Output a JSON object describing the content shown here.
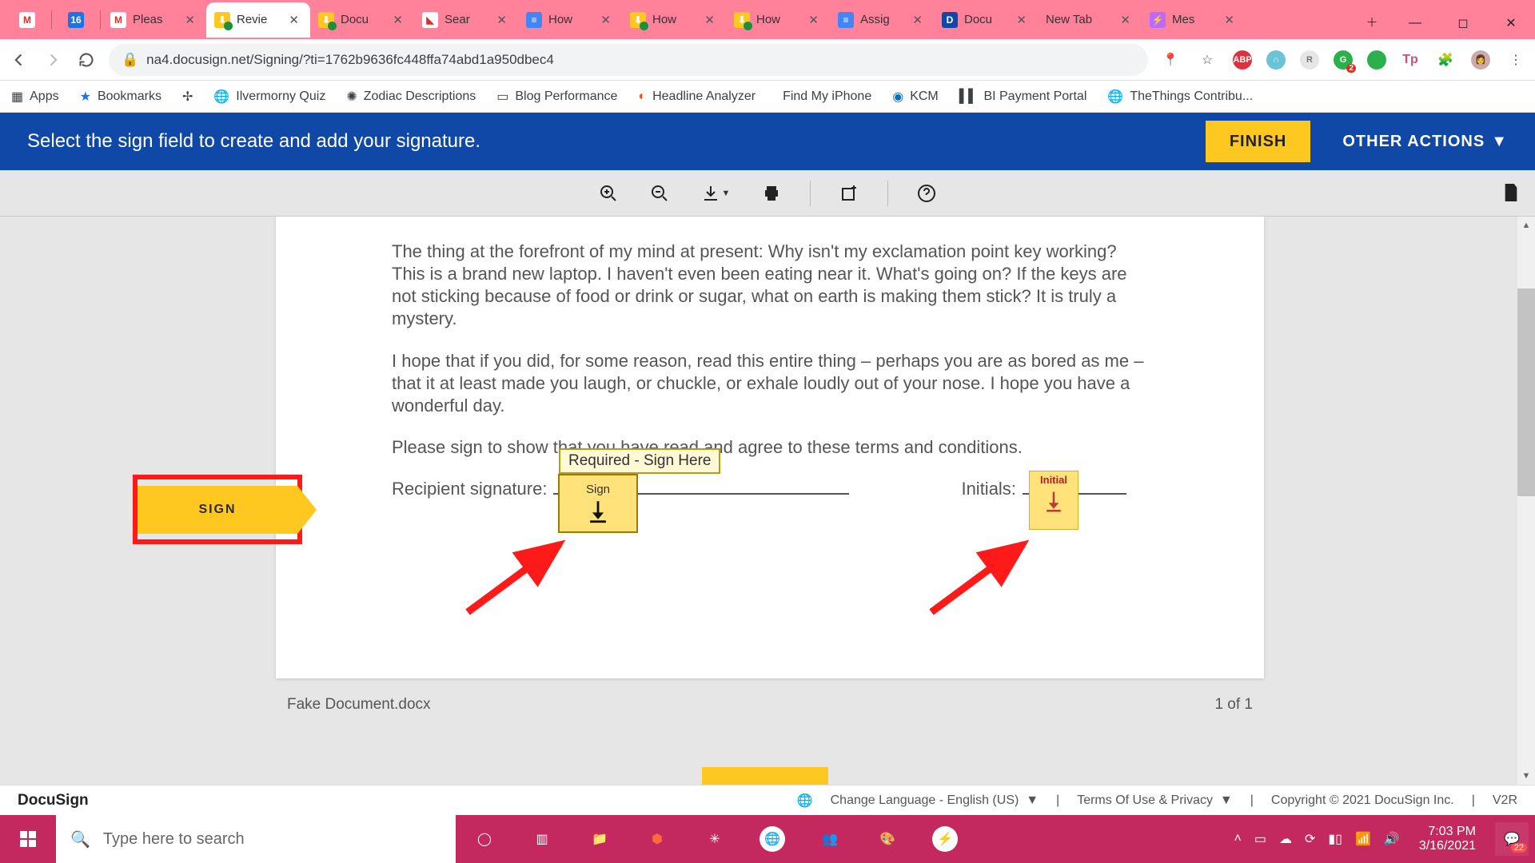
{
  "browser": {
    "tabs": [
      {
        "label": "",
        "mini": true,
        "favicon": "M",
        "fav_bg": "#fff"
      },
      {
        "label": "",
        "mini": true,
        "favicon": "16",
        "fav_bg": "#1a73e8"
      },
      {
        "label": "Pleas",
        "favicon": "M",
        "fav_bg": "#fff"
      },
      {
        "label": "Revie",
        "favicon": "⬇",
        "fav_bg": "#ffc820",
        "active": true
      },
      {
        "label": "Docu",
        "favicon": "⬇",
        "fav_bg": "#ffc820"
      },
      {
        "label": "Sear",
        "favicon": "◣",
        "fav_bg": "#fff"
      },
      {
        "label": "How",
        "favicon": "≡",
        "fav_bg": "#4285f4"
      },
      {
        "label": "How",
        "favicon": "⬇",
        "fav_bg": "#ffc820"
      },
      {
        "label": "How",
        "favicon": "⬇",
        "fav_bg": "#ffc820"
      },
      {
        "label": "Assig",
        "favicon": "≡",
        "fav_bg": "#4285f4"
      },
      {
        "label": "Docu",
        "favicon": "D",
        "fav_bg": "#1048a8"
      },
      {
        "label": "New Tab",
        "favicon": "",
        "fav_bg": "transparent"
      },
      {
        "label": "Mes",
        "favicon": "⚡",
        "fav_bg": "#b96bff"
      }
    ],
    "url": "na4.docusign.net/Signing/?ti=1762b9636fc448ffa74abd1a950dbec4",
    "bookmarks": [
      "Apps",
      "Bookmarks",
      "",
      "Ilvermorny Quiz",
      "Zodiac Descriptions",
      "Blog Performance",
      "Headline Analyzer",
      "Find My iPhone",
      "KCM",
      "BI Payment Portal",
      "TheThings Contribu..."
    ]
  },
  "docusign": {
    "banner_msg": "Select the sign field to create and add your signature.",
    "finish": "FINISH",
    "other": "OTHER ACTIONS",
    "doc_name": "Fake Document.docx",
    "page_of": "1 of 1",
    "sign_nav": "SIGN",
    "sign_tab": "Sign",
    "sign_tooltip": "Required - Sign Here",
    "initial_tab": "Initial",
    "body_p1": "The thing at the forefront of my mind at present: Why isn't my exclamation point key working? This is a brand new laptop. I haven't even been eating near it. What's going on? If the keys are not sticking because of food or drink or sugar, what on earth is making them stick? It is truly a mystery.",
    "body_p2": "I hope that if you did, for some reason, read this entire thing – perhaps you are as bored as me – that it at least made you laugh, or chuckle, or exhale loudly out of your nose. I hope you have a wonderful day.",
    "body_p3": "Please sign to show that you have read and agree to these terms and conditions.",
    "recipient_sig": "Recipient signature:",
    "initials": "Initials:",
    "footer_logo": "DocuSign",
    "footer_lang": "Change Language - English (US)",
    "footer_terms": "Terms Of Use & Privacy",
    "footer_copy": "Copyright © 2021 DocuSign Inc.",
    "footer_ver": "V2R"
  },
  "taskbar": {
    "search_placeholder": "Type here to search",
    "time": "7:03 PM",
    "date": "3/16/2021",
    "notif_count": "22"
  }
}
